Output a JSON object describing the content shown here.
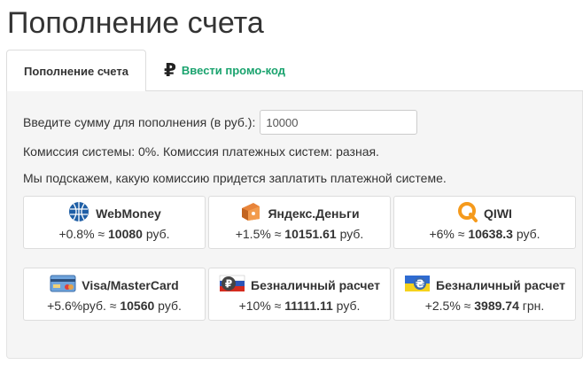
{
  "page": {
    "title": "Пополнение счета"
  },
  "tabs": {
    "active_label": "Пополнение счета",
    "promo_label": "Ввести промо-код",
    "promo_icon": "ruble-icon"
  },
  "form": {
    "amount_label": "Введите сумму для пополнения (в руб.):",
    "amount_value": "10000"
  },
  "info": {
    "commission": "Комиссия системы: 0%. Комиссия платежных систем: разная.",
    "hint": "Мы подскажем, какую комиссию придется заплатить платежной системе."
  },
  "payment_methods": [
    {
      "name": "WebMoney",
      "icon": "webmoney-globe-icon",
      "pct": "+0.8% ≈ ",
      "amount": "10080",
      "currency": " руб."
    },
    {
      "name": "Яндекс.Деньги",
      "icon": "yandex-money-icon",
      "pct": "+1.5% ≈ ",
      "amount": "10151.61",
      "currency": " руб."
    },
    {
      "name": "QIWI",
      "icon": "qiwi-icon",
      "pct": "+6% ≈ ",
      "amount": "10638.3",
      "currency": " руб."
    },
    {
      "name": "Visa/MasterCard",
      "icon": "credit-card-icon",
      "pct": "+5.6%руб. ≈ ",
      "amount": "10560",
      "currency": " руб."
    },
    {
      "name": "Безналичный расчет",
      "icon": "russia-flag-ruble-icon",
      "pct": "+10% ≈ ",
      "amount": "11111.11",
      "currency": " руб."
    },
    {
      "name": "Безналичный расчет",
      "icon": "ukraine-flag-hryvnia-icon",
      "pct": "+2.5% ≈ ",
      "amount": "3989.74",
      "currency": " грн."
    }
  ],
  "colors": {
    "promo_green": "#1aa36e",
    "panel_bg": "#f5f5f5",
    "webmoney_blue": "#1f5fa6",
    "qiwi_orange": "#f59a1c"
  }
}
